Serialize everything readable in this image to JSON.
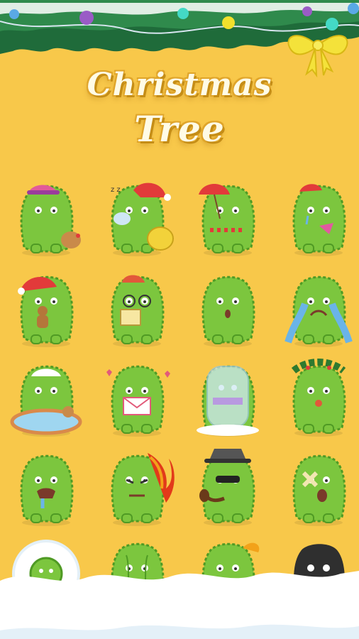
{
  "title": {
    "line1": "Christmas",
    "line2": "Tree"
  },
  "colors": {
    "background": "#f8c84a",
    "monster_green": "#7cc63e",
    "monster_dark": "#4f9a24",
    "garland": "#1f6b3a",
    "snow": "#ffffff",
    "ribbon": "#f4e23a"
  },
  "garland_lights": [
    "#5aa9e6",
    "#9a5cc6",
    "#f2e02c",
    "#44d9c5",
    "#ffffff",
    "#9a5cc6",
    "#f2e02c",
    "#5aa9e6"
  ],
  "stickers": [
    {
      "name": "monster-with-cap-and-reindeer",
      "prop": "cap-reindeer"
    },
    {
      "name": "monster-sleeping-santa-hat",
      "prop": "santa-sack"
    },
    {
      "name": "monster-umbrella",
      "prop": "umbrella"
    },
    {
      "name": "monster-crying-red-hat",
      "prop": "hanky"
    },
    {
      "name": "monster-santa-gingerbread",
      "prop": "gingerbread"
    },
    {
      "name": "monster-glasses-singing",
      "prop": "songbook"
    },
    {
      "name": "monster-surprised",
      "prop": "none"
    },
    {
      "name": "monster-crying-tears",
      "prop": "tears"
    },
    {
      "name": "monster-hot-tub-reindeer",
      "prop": "tub"
    },
    {
      "name": "monster-love-letter",
      "prop": "letter"
    },
    {
      "name": "monster-frozen",
      "prop": "ice"
    },
    {
      "name": "monster-holly-wreath",
      "prop": "holly"
    },
    {
      "name": "monster-crying-drool",
      "prop": "drool"
    },
    {
      "name": "monster-on-fire-angry",
      "prop": "fire"
    },
    {
      "name": "monster-gangster-pipe",
      "prop": "pipe"
    },
    {
      "name": "monster-bandaged-shocked",
      "prop": "bandage"
    },
    {
      "name": "monster-in-snow-ring",
      "prop": "snow-ring"
    },
    {
      "name": "monster-standing-back",
      "prop": "back"
    },
    {
      "name": "monster-jack-in-box",
      "prop": "gift-box"
    },
    {
      "name": "monster-burnt-black",
      "prop": "burnt"
    }
  ]
}
